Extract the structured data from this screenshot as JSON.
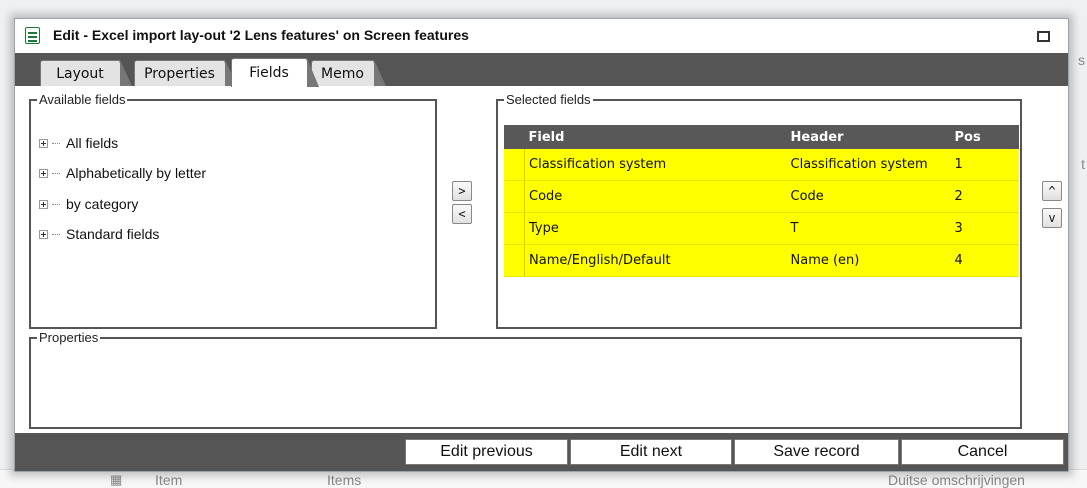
{
  "window": {
    "title": "Edit - Excel import lay-out '2 Lens features' on Screen features",
    "maximize_icon": "maximize-icon",
    "title_icon": "form-icon"
  },
  "tabs": [
    {
      "label": "Layout",
      "active": false
    },
    {
      "label": "Properties",
      "active": false
    },
    {
      "label": "Fields",
      "active": true
    },
    {
      "label": "Memo",
      "active": false
    }
  ],
  "available_fields": {
    "legend": "Available fields",
    "items": [
      "All fields",
      "Alphabetically by letter",
      "by category",
      "Standard fields"
    ]
  },
  "transfer": {
    "add_label": ">",
    "remove_label": "<"
  },
  "selected_fields": {
    "legend": "Selected fields",
    "columns": [
      "Field",
      "Header",
      "Pos"
    ],
    "rows": [
      {
        "field": "Classification system",
        "header": "Classification system",
        "pos": "1"
      },
      {
        "field": "Code",
        "header": "Code",
        "pos": "2"
      },
      {
        "field": "Type",
        "header": "T",
        "pos": "3"
      },
      {
        "field": "Name/English/Default",
        "header": "Name (en)",
        "pos": "4"
      }
    ],
    "highlight_color": "#ffff00"
  },
  "order": {
    "up_label": "^",
    "down_label": "v"
  },
  "properties": {
    "legend": "Properties"
  },
  "buttons": {
    "edit_previous": "Edit previous",
    "edit_next": "Edit next",
    "save_record": "Save record",
    "cancel": "Cancel"
  },
  "background": {
    "item": "Item",
    "items": "Items",
    "dutch": "Duitse omschrijvingen",
    "edge_s": "s",
    "edge_t": "t"
  }
}
